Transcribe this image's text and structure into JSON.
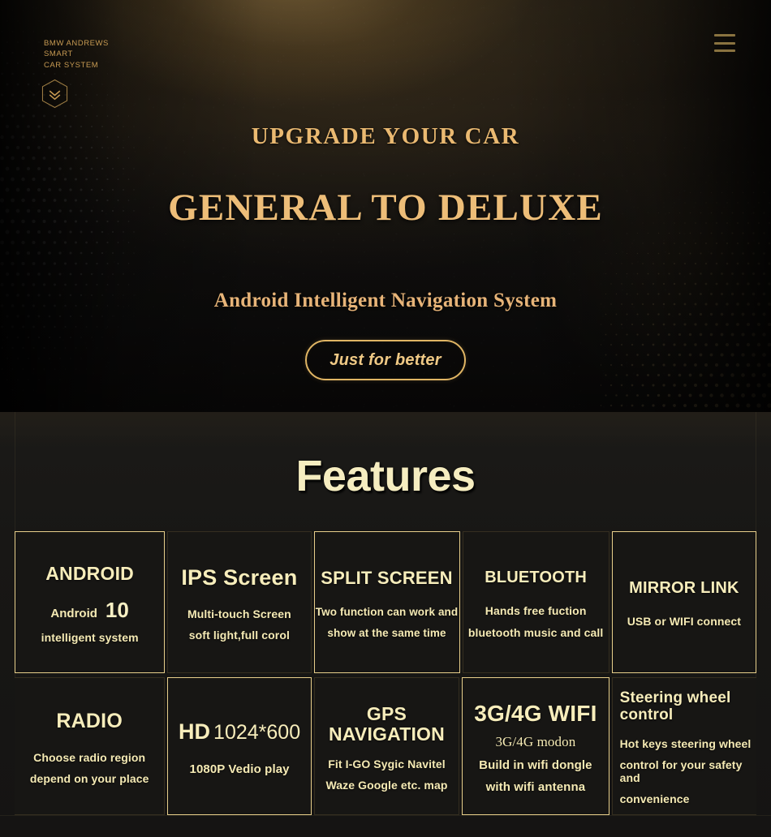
{
  "header": {
    "brand_line1": "BMW ANDREWS",
    "brand_line2": "SMART",
    "brand_line3": "CAR SYSTEM",
    "menu_icon": "hamburger-icon",
    "badge_icon": "hexagon-chevron-down-icon",
    "gold": "#c79a52"
  },
  "hero": {
    "eyebrow": "UPGRADE YOUR CAR",
    "headline": "GENERAL TO DELUXE",
    "subhead": "Android  Intelligent Navigation System",
    "cta_label": "Just for better",
    "accent": "#eab971",
    "cta_border": "#e0b564"
  },
  "features": {
    "title": "Features",
    "title_color": "#f6edc0",
    "border_color": "#e8cf8b",
    "rows": [
      {
        "cells": [
          {
            "title": "ANDROID",
            "version_label": "Android",
            "version_number": "10",
            "lines": [
              "intelligent system"
            ]
          },
          {
            "title": "IPS Screen",
            "lines": [
              "Multi-touch Screen",
              "soft light,full corol"
            ]
          },
          {
            "title": "SPLIT SCREEN",
            "lines": [
              "Two function can work and",
              "show at the same time"
            ]
          },
          {
            "title": "BLUETOOTH",
            "lines": [
              "Hands free fuction",
              "bluetooth music and call"
            ]
          },
          {
            "title": "MIRROR LINK",
            "lines": [
              "USB or WIFI  connect"
            ]
          }
        ]
      },
      {
        "cells": [
          {
            "title": "RADIO",
            "lines": [
              "Choose radio region",
              "depend on your place"
            ]
          },
          {
            "title_hd": "HD",
            "title_res": "1024*600",
            "lines": [
              "1080P   Vedio play"
            ]
          },
          {
            "title": "GPS NAVIGATION",
            "lines": [
              "Fit I-GO Sygic Navitel",
              "Waze Google etc. map"
            ]
          },
          {
            "title": "3G/4G WIFI",
            "serif_line": "3G/4G modon",
            "lines": [
              "Build in wifi dongle",
              "with wifi antenna"
            ]
          },
          {
            "title": "Steering wheel control",
            "lines": [
              "Hot keys steering wheel",
              "control for your safety and",
              "convenience"
            ]
          }
        ]
      }
    ]
  }
}
